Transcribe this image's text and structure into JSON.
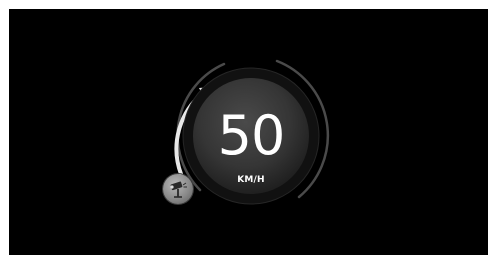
{
  "speedometer": {
    "speed_value": "50",
    "speed_unit": "KM/H",
    "speed_arc_fraction": 0.3
  },
  "icons": {
    "camera_badge": "speed-camera-icon"
  },
  "colors": {
    "background": "#000000",
    "dial_face": "#3a3a3a",
    "arc_active": "#e6e6e6",
    "arc_track": "#5c5c5c",
    "text": "#ffffff"
  }
}
